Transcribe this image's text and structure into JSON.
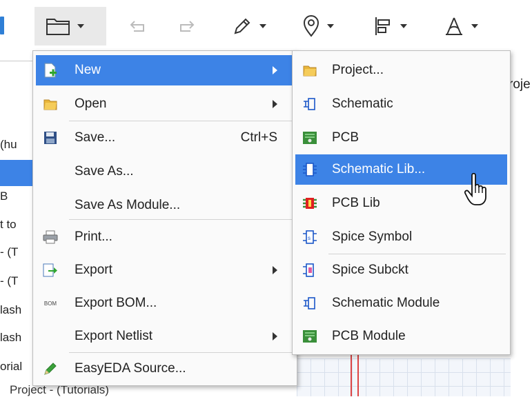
{
  "background": {
    "left_items": [
      "(hu",
      "B",
      "t to",
      "- (T",
      "- (T",
      "lash",
      "lash",
      "orial"
    ],
    "bottom_text": "Project - (Tutorials)",
    "right_text": "roje"
  },
  "main_menu": {
    "items": [
      {
        "label": "New",
        "has_submenu": true,
        "highlighted": true,
        "icon": "new-doc-icon"
      },
      {
        "label": "Open",
        "has_submenu": true,
        "icon": "folder-icon"
      },
      {
        "label": "Save...",
        "shortcut": "Ctrl+S",
        "icon": "floppy-icon"
      },
      {
        "label": "Save As...",
        "icon": ""
      },
      {
        "label": "Save As Module...",
        "icon": ""
      },
      {
        "label": "Print...",
        "icon": "printer-icon"
      },
      {
        "label": "Export",
        "has_submenu": true,
        "icon": "export-icon"
      },
      {
        "label": "Export BOM...",
        "icon": "bom-icon",
        "icon_text": "BOM"
      },
      {
        "label": "Export Netlist",
        "has_submenu": true,
        "icon": ""
      },
      {
        "label": "EasyEDA Source...",
        "icon": "pencil-icon"
      }
    ]
  },
  "new_submenu": {
    "items": [
      {
        "label": "Project...",
        "icon": "folder-icon"
      },
      {
        "label": "Schematic",
        "icon": "schematic-icon"
      },
      {
        "label": "PCB",
        "icon": "pcb-icon"
      },
      {
        "label": "Schematic Lib...",
        "icon": "schematic-lib-icon",
        "highlighted": true
      },
      {
        "label": "PCB Lib",
        "icon": "pcb-lib-icon"
      },
      {
        "label": "Spice Symbol",
        "icon": "spice-symbol-icon",
        "icon_text": "S"
      },
      {
        "label": "Spice Subckt",
        "icon": "spice-subckt-icon",
        "icon_text": "S"
      },
      {
        "label": "Schematic Module",
        "icon": "schematic-module-icon"
      },
      {
        "label": "PCB Module",
        "icon": "pcb-icon"
      }
    ]
  },
  "colors": {
    "highlight": "#3d83e6",
    "menu_bg": "#fafafa",
    "pcb_green": "#3a8f3a",
    "pcb_lib_red": "#e02020",
    "folder_yellow": "#e8b53a"
  }
}
